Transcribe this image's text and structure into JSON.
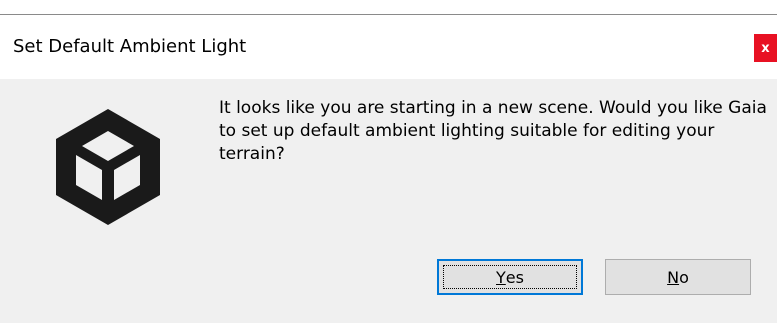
{
  "window": {
    "title": "Set Default Ambient Light",
    "close_label": "x"
  },
  "message": {
    "text": "It looks like you are starting in a new scene. Would you like Gaia to set up default ambient lighting suitable for editing your terrain?"
  },
  "buttons": {
    "yes": {
      "accel": "Y",
      "rest": "es"
    },
    "no": {
      "accel": "N",
      "rest": "o"
    }
  },
  "icons": {
    "logo": "unity-logo-icon",
    "close": "close-icon"
  },
  "colors": {
    "close_bg": "#e81123",
    "content_bg": "#f0f0f0",
    "focus_border": "#0078d7",
    "button_bg": "#e1e1e1"
  }
}
